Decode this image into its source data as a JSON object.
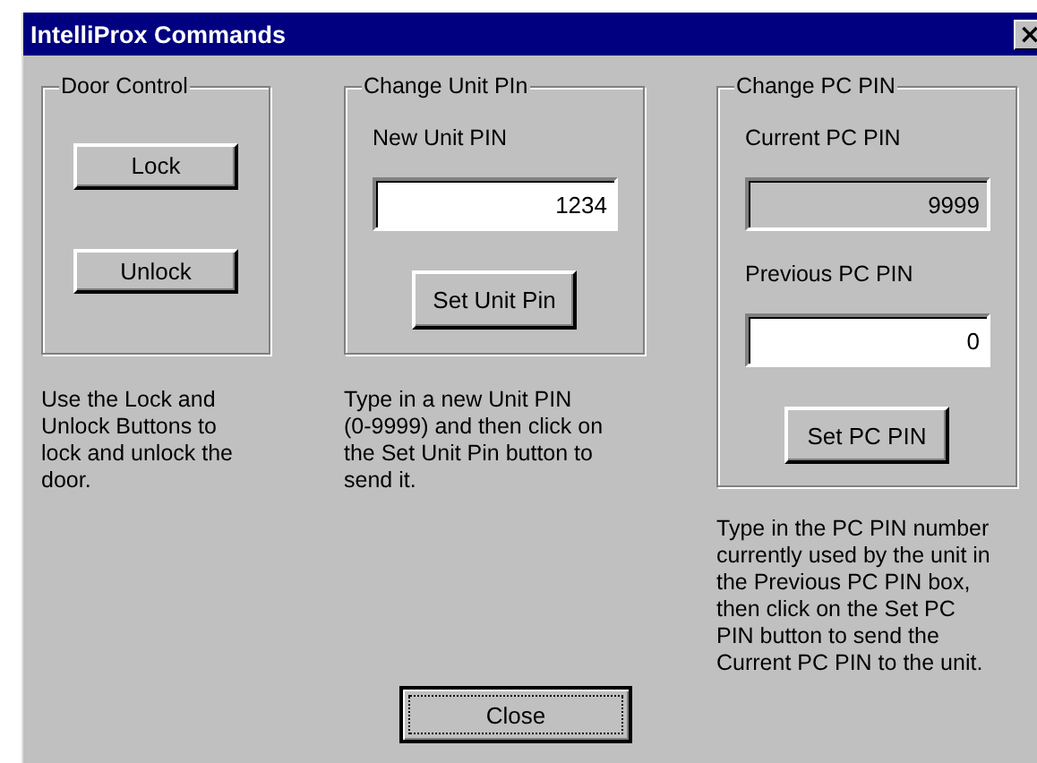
{
  "window": {
    "title": "IntelliProx Commands",
    "close": "×"
  },
  "door_control": {
    "title": "Door Control",
    "buttons": [
      "Lock",
      "Unlock"
    ],
    "help": [
      "Use the Lock and",
      "Unlock Buttons to",
      "lock and unlock the",
      "door."
    ]
  },
  "unit_pin": {
    "title": "Change Unit PIn",
    "label": "New Unit PIN",
    "value": "1234",
    "button": "Set Unit Pin",
    "help": [
      "Type in a new Unit PIN",
      "(0-9999) and then click on",
      "the Set Unit Pin button to",
      "send it."
    ]
  },
  "pc_pin": {
    "title": "Change PC PIN",
    "fields": [
      {
        "label": "Current PC PIN",
        "value": "9999",
        "disabled": true
      },
      {
        "label": "Previous PC PIN",
        "value": "0",
        "disabled": false
      }
    ],
    "button": "Set PC PIN",
    "help": [
      "Type in the PC PIN number",
      "currently used by the unit in",
      "the Previous PC PIN box,",
      "then click on the Set PC",
      "PIN button to send the",
      "Current PC PIN to the unit."
    ]
  },
  "close_button": {
    "label": "Close",
    "focused": true
  }
}
